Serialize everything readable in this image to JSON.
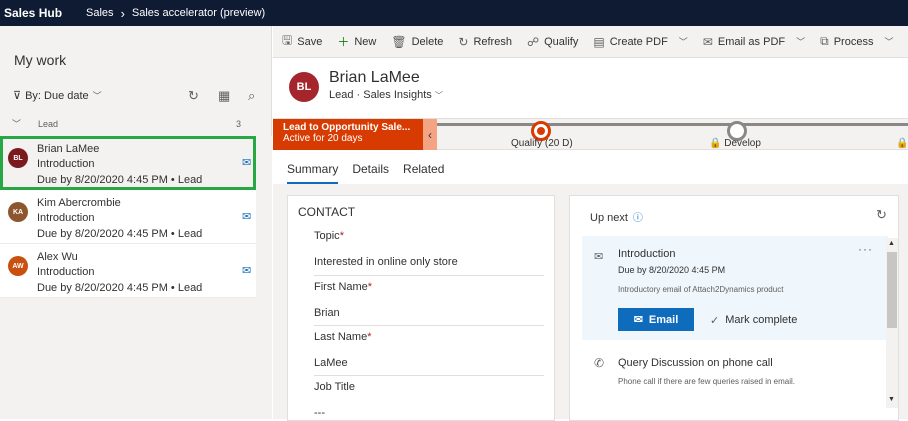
{
  "topbar": {
    "app": "Sales Hub",
    "area": "Sales",
    "page": "Sales accelerator (preview)"
  },
  "worklist": {
    "title": "My work",
    "filter_label": "By: Due date",
    "group_label": "Lead",
    "group_count": "3",
    "items": [
      {
        "initials": "BL",
        "color": "#7a1a1e",
        "name": "Brian LaMee",
        "subject": "Introduction",
        "due": "Due by 8/20/2020 4:45 PM • Lead"
      },
      {
        "initials": "KA",
        "color": "#8e562e",
        "name": "Kim Abercrombie",
        "subject": "Introduction",
        "due": "Due by 8/20/2020 4:45 PM • Lead"
      },
      {
        "initials": "AW",
        "color": "#ca5010",
        "name": "Alex Wu",
        "subject": "Introduction",
        "due": "Due by 8/20/2020 4:45 PM • Lead"
      }
    ]
  },
  "commands": {
    "save": "Save",
    "new": "New",
    "delete": "Delete",
    "refresh": "Refresh",
    "qualify": "Qualify",
    "create_pdf": "Create PDF",
    "email_pdf": "Email as PDF",
    "process": "Process"
  },
  "record": {
    "initials": "BL",
    "name": "Brian LaMee",
    "type": "Lead",
    "form": "Sales Insights"
  },
  "bpf": {
    "stage_title": "Lead to Opportunity Sale...",
    "stage_sub": "Active for 20 days",
    "stages": [
      "Qualify  (20 D)",
      "Develop"
    ]
  },
  "tabs": [
    "Summary",
    "Details",
    "Related"
  ],
  "contact": {
    "header": "CONTACT",
    "topic_label": "Topic",
    "topic_value": "Interested in online only store",
    "first_label": "First Name",
    "first_value": "Brian",
    "last_label": "Last Name",
    "last_value": "LaMee",
    "job_label": "Job Title",
    "job_value": "---"
  },
  "upnext": {
    "title": "Up next",
    "card": {
      "title": "Introduction",
      "due": "Due by 8/20/2020 4:45 PM",
      "desc": "Introductory email of Attach2Dynamics product",
      "email_btn": "Email",
      "mark": "Mark complete"
    },
    "task2": {
      "title": "Query Discussion on phone call",
      "desc": "Phone call if there are few queries raised in email."
    }
  }
}
